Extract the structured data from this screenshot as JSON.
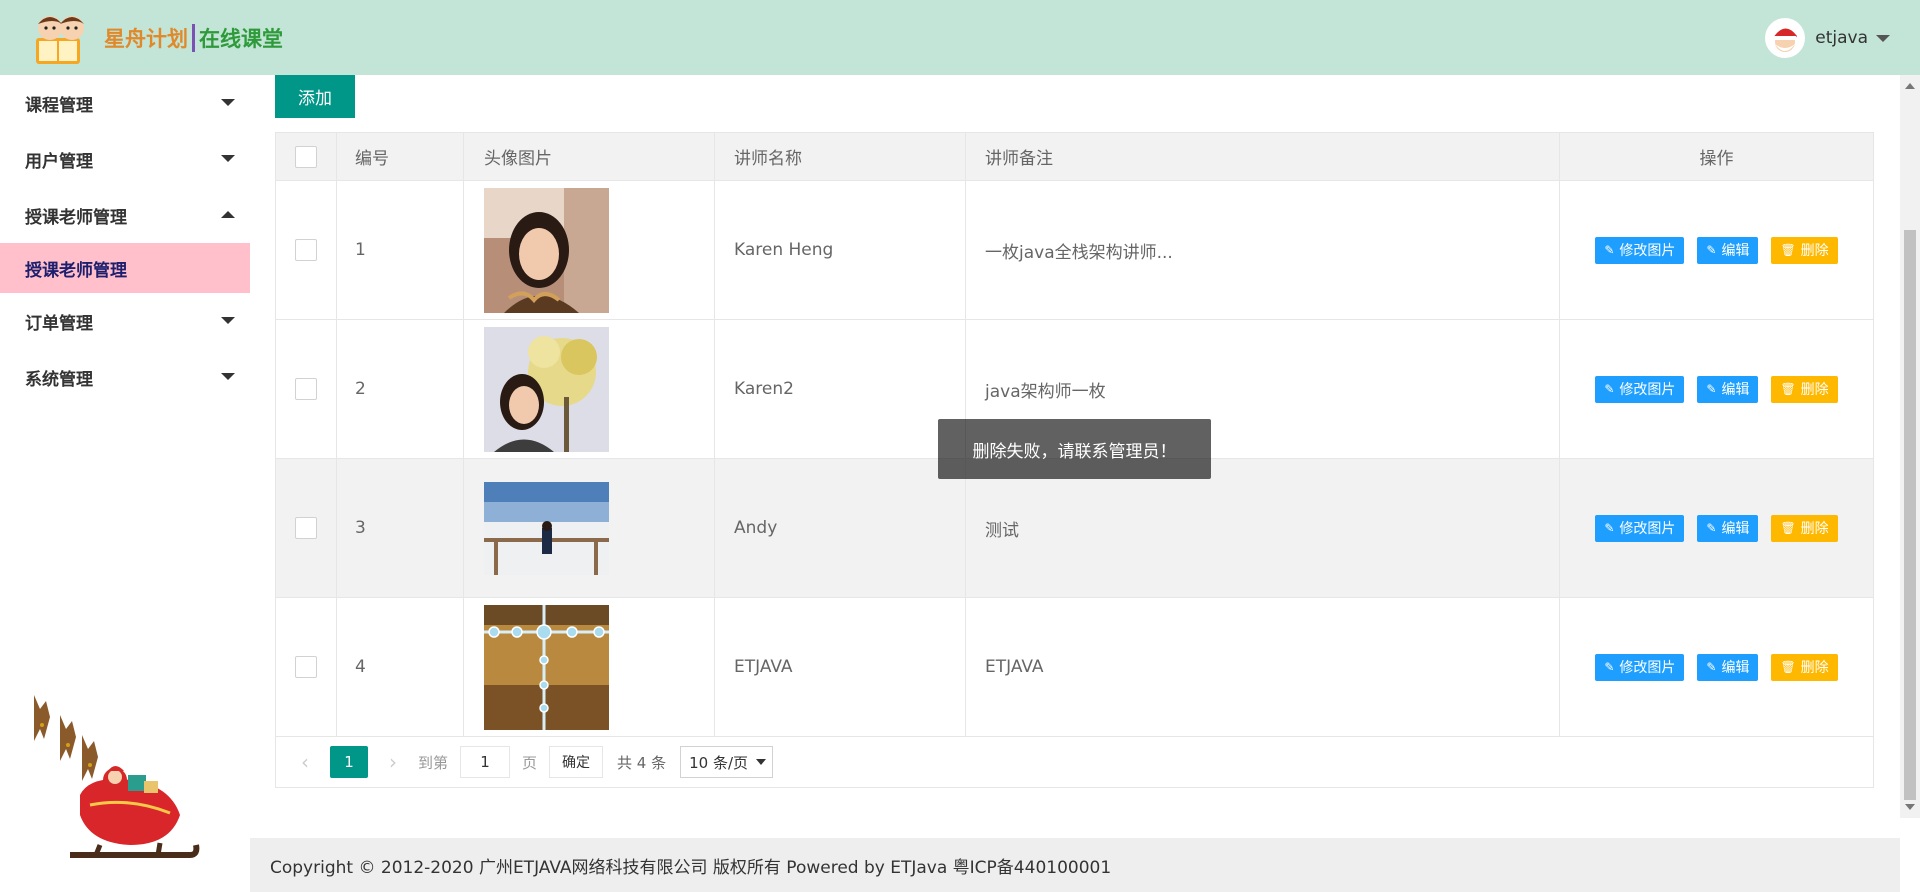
{
  "header": {
    "logo_text_a": "星舟计划",
    "logo_text_b": "在线课堂",
    "username": "etjava"
  },
  "sidebar": {
    "items": [
      {
        "label": "课程管理",
        "expanded": false
      },
      {
        "label": "用户管理",
        "expanded": false
      },
      {
        "label": "授课老师管理",
        "expanded": true,
        "sub": "授课老师管理"
      },
      {
        "label": "订单管理",
        "expanded": false
      },
      {
        "label": "系统管理",
        "expanded": false
      }
    ]
  },
  "toolbar": {
    "add_label": "添加"
  },
  "table": {
    "columns": [
      "编号",
      "头像图片",
      "讲师名称",
      "讲师备注",
      "操作"
    ],
    "rows": [
      {
        "id": "1",
        "name": "Karen Heng",
        "remark": "一枚java全栈架构讲师..."
      },
      {
        "id": "2",
        "name": "Karen2",
        "remark": "java架构师一枚"
      },
      {
        "id": "3",
        "name": "Andy",
        "remark": "测试"
      },
      {
        "id": "4",
        "name": "ETJAVA",
        "remark": "ETJAVA"
      }
    ],
    "actions": {
      "edit_image": "修改图片",
      "edit": "编辑",
      "delete": "删除"
    }
  },
  "pager": {
    "current": "1",
    "goto_label": "到第",
    "goto_value": "1",
    "page_label": "页",
    "confirm": "确定",
    "total": "共 4 条",
    "page_size": "10 条/页"
  },
  "toast": "删除失败，请联系管理员！",
  "footer": "Copyright © 2012-2020 广州ETJAVA网络科技有限公司 版权所有 Powered by ETJava 粤ICP备440100001",
  "colors": {
    "header_bg": "#c2e5d8",
    "primary": "#009688",
    "blue": "#1e9fff",
    "orange": "#ffb800",
    "active_nav": "#ffc0cb"
  }
}
